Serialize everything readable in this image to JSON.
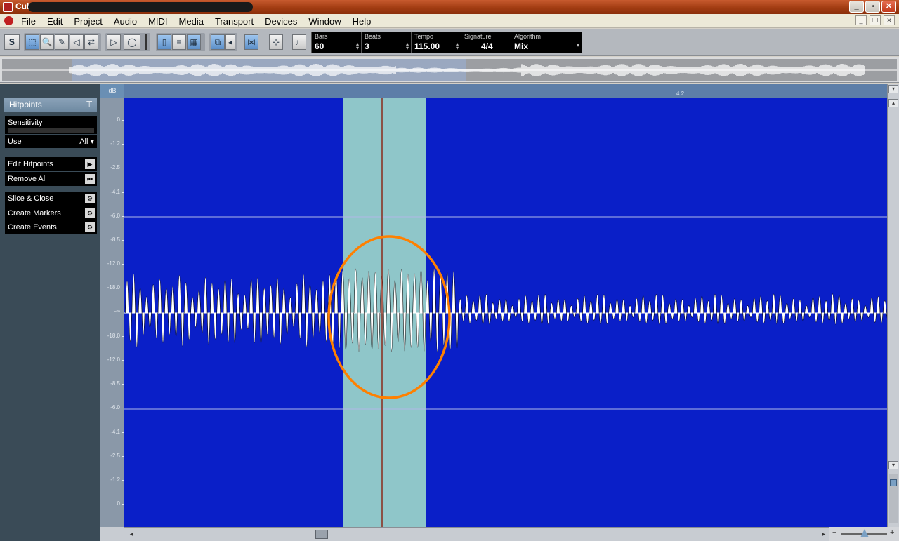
{
  "window": {
    "title": "Cubase Essential 5"
  },
  "menu": {
    "items": [
      "File",
      "Edit",
      "Project",
      "Audio",
      "MIDI",
      "Media",
      "Transport",
      "Devices",
      "Window",
      "Help"
    ]
  },
  "toolbar": {
    "solo_label": "S",
    "fields": {
      "bars": {
        "label": "Bars",
        "value": "60"
      },
      "beats": {
        "label": "Beats",
        "value": "3"
      },
      "tempo": {
        "label": "Tempo",
        "value": "115.00"
      },
      "signature": {
        "label": "Signature",
        "value": "4/4"
      },
      "algorithm": {
        "label": "Algorithm",
        "value": "Mix"
      }
    },
    "icons": [
      "object-selection-icon",
      "zoom-icon",
      "pencil-icon",
      "audition-icon",
      "warp-icon",
      "play-icon",
      "loop-icon",
      "snap-icon",
      "hitpoint-mode-icon",
      "autoscroll-icon",
      "metronome-icon"
    ]
  },
  "inspector": {
    "header": "Hitpoints",
    "sensitivity_label": "Sensitivity",
    "sensitivity_level": 0.0,
    "use_label": "Use",
    "use_value": "All",
    "edit_hitpoints": "Edit Hitpoints",
    "remove_all": "Remove All",
    "slice_close": "Slice & Close",
    "create_markers": "Create Markers",
    "create_events": "Create Events"
  },
  "editor": {
    "db_header": "dB",
    "bar_marker": "4.2",
    "db_scale": [
      "0",
      "-1.2",
      "-2.5",
      "-4.1",
      "-6.0",
      "-8.5",
      "-12.0",
      "-18.0",
      "-∞",
      "-18.0",
      "-12.0",
      "-8.5",
      "-6.0",
      "-4.1",
      "-2.5",
      "-1.2",
      "0"
    ],
    "colors": {
      "waveform_background": "#0a1fc8",
      "selection": "#8fc6c9",
      "cursor": "#8a2a1a",
      "annotation": "#ff8000",
      "waveform": "#ffffff"
    }
  }
}
